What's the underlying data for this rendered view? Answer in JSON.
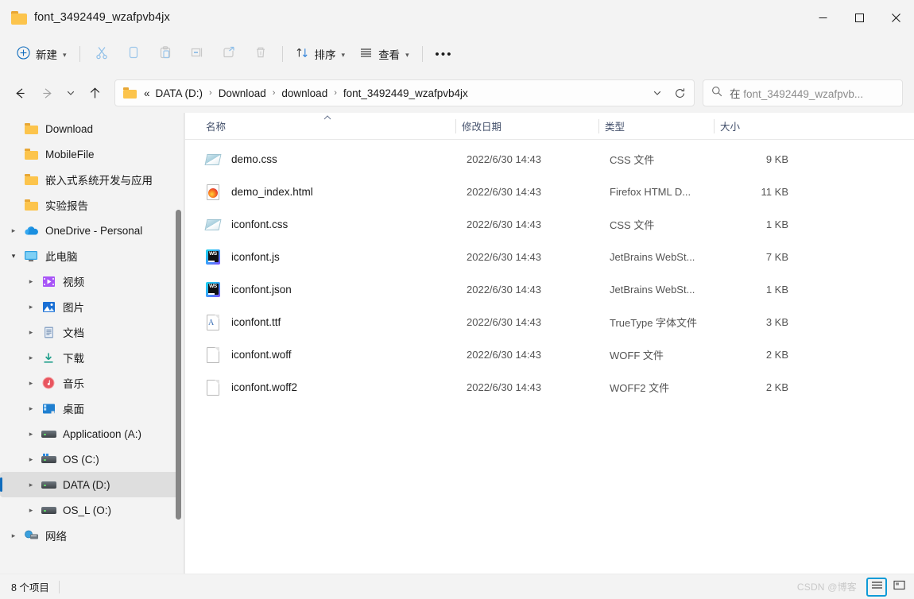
{
  "window": {
    "title": "font_3492449_wzafpvb4jx",
    "folder_icon": "folder-icon",
    "controls": {
      "minimize": "minimize-icon",
      "maximize": "maximize-icon",
      "close": "close-icon"
    }
  },
  "toolbar": {
    "new_label": "新建",
    "new_icon": "plus-circle-icon",
    "cut_icon": "scissors-icon",
    "copy_icon": "copy-icon",
    "paste_icon": "clipboard-icon",
    "rename_icon": "rename-icon",
    "share_icon": "share-icon",
    "delete_icon": "trash-icon",
    "sort_label": "排序",
    "sort_icon": "sort-arrows-icon",
    "view_label": "查看",
    "view_icon": "view-lines-icon",
    "more_label": "•••"
  },
  "address": {
    "back_icon": "arrow-left-icon",
    "forward_icon": "arrow-right-icon",
    "recent_icon": "chevron-down-icon",
    "up_icon": "arrow-up-icon",
    "folder_icon": "folder-icon",
    "overflow": "«",
    "crumbs": [
      "DATA (D:)",
      "Download",
      "download",
      "font_3492449_wzafpvb4jx"
    ],
    "separator": "›",
    "dropdown_icon": "chevron-down-icon",
    "refresh_icon": "refresh-icon"
  },
  "search": {
    "icon": "search-icon",
    "prefix": "在 ",
    "placeholder": "font_3492449_wzafpvb..."
  },
  "sidebar": {
    "quick_items": [
      {
        "label": "Download",
        "icon": "folder-icon"
      },
      {
        "label": "MobileFile",
        "icon": "folder-icon"
      },
      {
        "label": "嵌入式系统开发与应用",
        "icon": "folder-icon"
      },
      {
        "label": "实验报告",
        "icon": "folder-icon"
      }
    ],
    "onedrive": {
      "label": "OneDrive - Personal",
      "icon": "cloud-icon",
      "expanded": false
    },
    "this_pc": {
      "label": "此电脑",
      "icon": "monitor-icon",
      "expanded": true
    },
    "pc_children": [
      {
        "label": "视频",
        "icon": "video-icon"
      },
      {
        "label": "图片",
        "icon": "pictures-icon"
      },
      {
        "label": "文档",
        "icon": "documents-icon"
      },
      {
        "label": "下载",
        "icon": "downloads-icon"
      },
      {
        "label": "音乐",
        "icon": "music-icon"
      },
      {
        "label": "桌面",
        "icon": "desktop-icon"
      },
      {
        "label": "Applicatioon (A:)",
        "icon": "drive-icon"
      },
      {
        "label": "OS (C:)",
        "icon": "system-drive-icon"
      },
      {
        "label": "DATA (D:)",
        "icon": "drive-icon",
        "selected": true
      },
      {
        "label": "OS_L (O:)",
        "icon": "drive-icon"
      }
    ],
    "network": {
      "label": "网络",
      "icon": "network-icon"
    }
  },
  "columns": {
    "name": "名称",
    "date": "修改日期",
    "type": "类型",
    "size": "大小",
    "sort_indicator": "^"
  },
  "files": [
    {
      "name": "demo.css",
      "date": "2022/6/30 14:43",
      "type": "CSS 文件",
      "size": "9 KB",
      "icon": "css-file-icon"
    },
    {
      "name": "demo_index.html",
      "date": "2022/6/30 14:43",
      "type": "Firefox HTML D...",
      "size": "11 KB",
      "icon": "firefox-html-file-icon"
    },
    {
      "name": "iconfont.css",
      "date": "2022/6/30 14:43",
      "type": "CSS 文件",
      "size": "1 KB",
      "icon": "css-file-icon"
    },
    {
      "name": "iconfont.js",
      "date": "2022/6/30 14:43",
      "type": "JetBrains WebSt...",
      "size": "7 KB",
      "icon": "webstorm-file-icon"
    },
    {
      "name": "iconfont.json",
      "date": "2022/6/30 14:43",
      "type": "JetBrains WebSt...",
      "size": "1 KB",
      "icon": "webstorm-file-icon"
    },
    {
      "name": "iconfont.ttf",
      "date": "2022/6/30 14:43",
      "type": "TrueType 字体文件",
      "size": "3 KB",
      "icon": "truetype-font-file-icon"
    },
    {
      "name": "iconfont.woff",
      "date": "2022/6/30 14:43",
      "type": "WOFF 文件",
      "size": "2 KB",
      "icon": "generic-file-icon"
    },
    {
      "name": "iconfont.woff2",
      "date": "2022/6/30 14:43",
      "type": "WOFF2 文件",
      "size": "2 KB",
      "icon": "generic-file-icon"
    }
  ],
  "status": {
    "item_count": "8 个项目",
    "watermark": "CSDN @博客",
    "details_view_icon": "details-view-icon",
    "large_icons_view_icon": "large-icons-view-icon"
  },
  "colors": {
    "accent": "#0f6cbd",
    "folder": "#fcc44c",
    "selection": "#dedede",
    "header_text": "#43506b",
    "toggle_active": "#0f9bd7"
  }
}
